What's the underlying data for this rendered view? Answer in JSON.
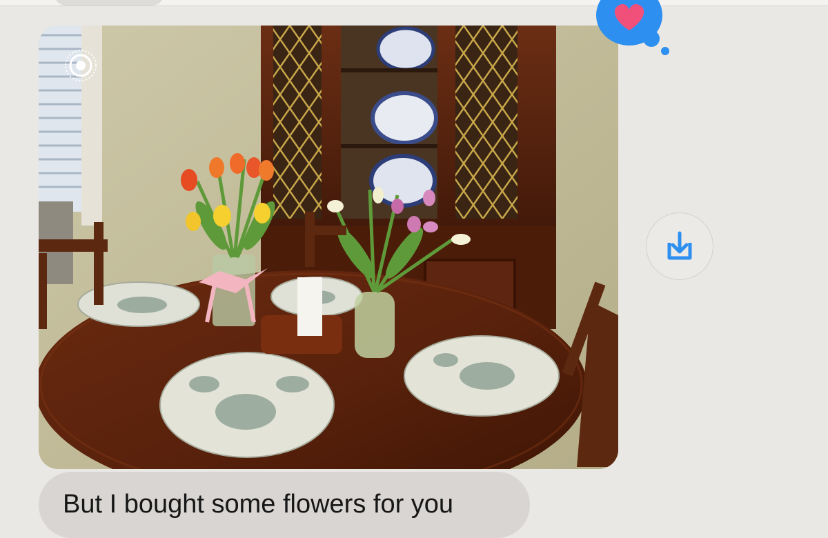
{
  "message": {
    "text": "But I bought some flowers for you"
  },
  "photo": {
    "live_indicator_icon": "live-photo-icon",
    "download_icon": "download-icon",
    "reaction_icon": "heart-icon"
  },
  "colors": {
    "background": "#eae8e5",
    "bubble_gray": "#d8d5d2",
    "accent_blue": "#2d8ff0",
    "heart_pink": "#f0507a"
  }
}
